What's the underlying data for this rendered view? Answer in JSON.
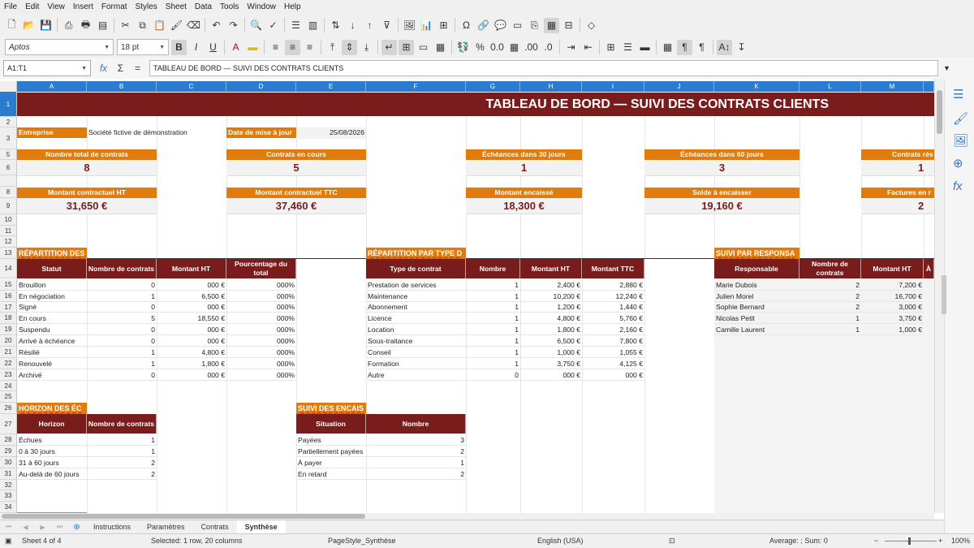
{
  "menu": [
    "File",
    "Edit",
    "View",
    "Insert",
    "Format",
    "Styles",
    "Sheet",
    "Data",
    "Tools",
    "Window",
    "Help"
  ],
  "toolbar": {
    "font_name": "Aptos",
    "font_size": "18 pt"
  },
  "formula_bar": {
    "cell_ref": "A1:T1",
    "content": "TABLEAU DE BORD — SUIVI DES CONTRATS CLIENTS"
  },
  "columns": [
    "A",
    "B",
    "C",
    "D",
    "E",
    "F",
    "G",
    "H",
    "I",
    "J",
    "K",
    "L",
    "M"
  ],
  "rows": [
    "1",
    "2",
    "3",
    "5",
    "6",
    "8",
    "9",
    "10",
    "11",
    "12",
    "13",
    "14",
    "15",
    "16",
    "17",
    "18",
    "19",
    "20",
    "21",
    "22",
    "23",
    "24",
    "25",
    "26",
    "27",
    "28",
    "29",
    "30",
    "31",
    "32",
    "33",
    "34"
  ],
  "sheet": {
    "title": "TABLEAU DE BORD — SUIVI DES CONTRATS CLIENTS",
    "company_label": "Entreprise",
    "company_value": "Société fictive de démonstration",
    "date_label": "Date de mise à jour",
    "date_value": "25/08/2026",
    "kpi": [
      {
        "label": "Nombre total de contrats",
        "value": "8"
      },
      {
        "label": "Contrats en cours",
        "value": "5"
      },
      {
        "label": "Échéances dans 30 jours",
        "value": "1"
      },
      {
        "label": "Échéances dans 60 jours",
        "value": "3"
      },
      {
        "label": "Contrats rés",
        "value": "1"
      },
      {
        "label": "Montant contractuel HT",
        "value": "31,650 €"
      },
      {
        "label": "Montant contractuel TTC",
        "value": "37,460 €"
      },
      {
        "label": "Montant encaissé",
        "value": "18,300 €"
      },
      {
        "label": "Solde à encaisser",
        "value": "19,160 €"
      },
      {
        "label": "Factures en r",
        "value": "2"
      }
    ],
    "status": {
      "title": "RÉPARTITION DES",
      "headers": [
        "Statut",
        "Nombre de contrats",
        "Montant HT",
        "Pourcentage du total"
      ],
      "rows": [
        [
          "Brouillon",
          "0",
          "000 €",
          "000%"
        ],
        [
          "En négociation",
          "1",
          "6,500 €",
          "000%"
        ],
        [
          "Signé",
          "0",
          "000 €",
          "000%"
        ],
        [
          "En cours",
          "5",
          "18,550 €",
          "000%"
        ],
        [
          "Suspendu",
          "0",
          "000 €",
          "000%"
        ],
        [
          "Arrivé à échéance",
          "0",
          "000 €",
          "000%"
        ],
        [
          "Résilié",
          "1",
          "4,800 €",
          "000%"
        ],
        [
          "Renouvelé",
          "1",
          "1,800 €",
          "000%"
        ],
        [
          "Archivé",
          "0",
          "000 €",
          "000%"
        ]
      ]
    },
    "type": {
      "title": "RÉPARTITION PAR TYPE D",
      "headers": [
        "Type de contrat",
        "Nombre",
        "Montant HT",
        "Montant TTC"
      ],
      "rows": [
        [
          "Prestation de services",
          "1",
          "2,400 €",
          "2,880 €"
        ],
        [
          "Maintenance",
          "1",
          "10,200 €",
          "12,240 €"
        ],
        [
          "Abonnement",
          "1",
          "1,200 €",
          "1,440 €"
        ],
        [
          "Licence",
          "1",
          "4,800 €",
          "5,760 €"
        ],
        [
          "Location",
          "1",
          "1,800 €",
          "2,160 €"
        ],
        [
          "Sous-traitance",
          "1",
          "6,500 €",
          "7,800 €"
        ],
        [
          "Conseil",
          "1",
          "1,000 €",
          "1,055 €"
        ],
        [
          "Formation",
          "1",
          "3,750 €",
          "4,125 €"
        ],
        [
          "Autre",
          "0",
          "000 €",
          "000 €"
        ]
      ]
    },
    "resp": {
      "title": "SUIVI PAR RESPONSA",
      "headers": [
        "Responsable",
        "Nombre de contrats",
        "Montant HT",
        "À"
      ],
      "rows": [
        [
          "Marie Dubois",
          "2",
          "7,200 €"
        ],
        [
          "Julien Morel",
          "2",
          "16,700 €"
        ],
        [
          "Sophie Bernard",
          "2",
          "3,000 €"
        ],
        [
          "Nicolas Petit",
          "1",
          "3,750 €"
        ],
        [
          "Camille Laurent",
          "1",
          "1,000 €"
        ]
      ]
    },
    "horizon": {
      "title": "HORIZON DES ÉC",
      "headers": [
        "Horizon",
        "Nombre de contrats"
      ],
      "rows": [
        [
          "Échues",
          "1"
        ],
        [
          "0 à 30 jours",
          "1"
        ],
        [
          "31 à 60 jours",
          "2"
        ],
        [
          "Au-delà de 60 jours",
          "2"
        ]
      ]
    },
    "encais": {
      "title": "SUIVI DES ENCAIS",
      "headers": [
        "Situation",
        "Nombre"
      ],
      "rows": [
        [
          "Payées",
          "3"
        ],
        [
          "Partiellement payées",
          "2"
        ],
        [
          "À payer",
          "1"
        ],
        [
          "En retard",
          "2"
        ]
      ]
    }
  },
  "tabs": [
    "Instructions",
    "Paramètres",
    "Contrats",
    "Synthèse"
  ],
  "status_bar": {
    "sheet": "Sheet 4 of 4",
    "selection": "Selected: 1 row, 20 columns",
    "page_style": "PageStyle_Synthèse",
    "language": "English (USA)",
    "summary": "Average: ; Sum: 0",
    "zoom": "100%"
  }
}
